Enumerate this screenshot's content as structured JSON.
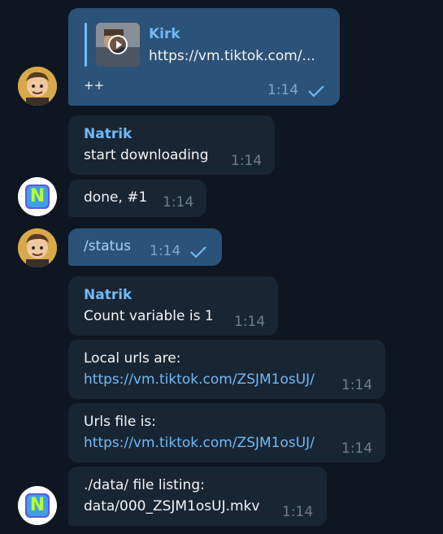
{
  "messages": {
    "m1": {
      "preview_title": "Kirk",
      "preview_url": "https://vm.tiktok.com/...",
      "text": "++",
      "time": "1:14"
    },
    "m2": {
      "sender": "Natrik",
      "text": "start downloading",
      "time": "1:14"
    },
    "m3": {
      "text": "done, #1",
      "time": "1:14"
    },
    "m4": {
      "text": "/status",
      "time": "1:14"
    },
    "m5": {
      "sender": "Natrik",
      "text": "Count variable is 1",
      "time": "1:14"
    },
    "m6": {
      "line1": "Local urls are:",
      "link": "https://vm.tiktok.com/ZSJM1osUJ/",
      "time": "1:14"
    },
    "m7": {
      "line1": "Urls file is:",
      "link": "https://vm.tiktok.com/ZSJM1osUJ/",
      "time": "1:14"
    },
    "m8": {
      "line1": "./data/ file listing:",
      "line2": "data/000_ZSJM1osUJ.mkv",
      "time": "1:14"
    }
  },
  "avatars": {
    "bot_letter": "N"
  },
  "icons": {
    "read_check": "check-icon",
    "play": "play-icon"
  },
  "colors": {
    "background": "#0e1621",
    "incoming_bubble": "#182533",
    "outgoing_bubble": "#2b5278",
    "accent": "#71baf7"
  }
}
